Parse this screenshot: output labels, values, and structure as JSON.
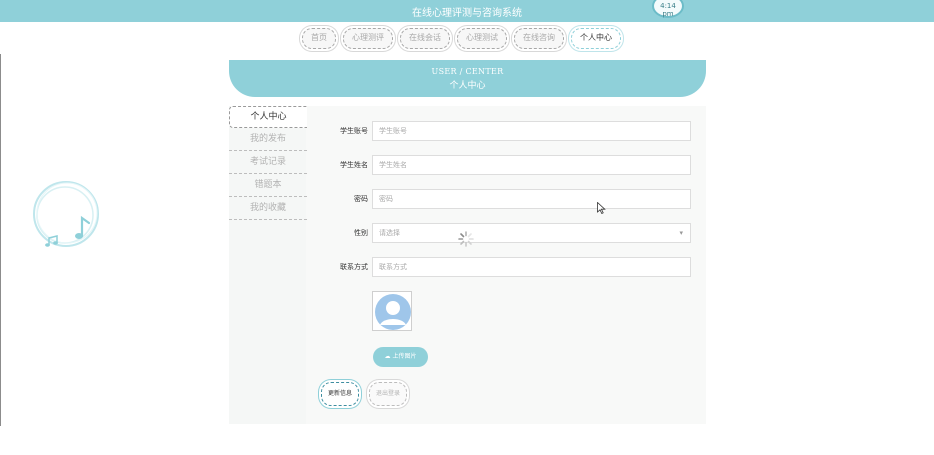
{
  "app": {
    "title": "在线心理评测与咨询系统",
    "time_badge": "4:14 pm"
  },
  "nav": {
    "items": [
      {
        "label": "首页"
      },
      {
        "label": "心理测评"
      },
      {
        "label": "在线会话"
      },
      {
        "label": "心理测试"
      },
      {
        "label": "在线咨询"
      },
      {
        "label": "个人中心"
      }
    ],
    "active_index": 5
  },
  "banner": {
    "en": "USER / CENTER",
    "zh": "个人中心"
  },
  "sidebar": {
    "items": [
      {
        "label": "个人中心"
      },
      {
        "label": "我的发布"
      },
      {
        "label": "考试记录"
      },
      {
        "label": "错题本"
      },
      {
        "label": "我的收藏"
      }
    ],
    "active_index": 0
  },
  "form": {
    "student_no": {
      "label": "学生账号",
      "placeholder": "学生账号"
    },
    "student_name": {
      "label": "学生姓名",
      "placeholder": "学生姓名"
    },
    "password": {
      "label": "密码",
      "placeholder": "密码"
    },
    "gender": {
      "label": "性别",
      "value": "请选择"
    },
    "contact": {
      "label": "联系方式",
      "placeholder": "联系方式"
    },
    "upload_label": "上传图片"
  },
  "actions": {
    "save_label": "更新信息",
    "logout_label": "退出登录"
  },
  "colors": {
    "accent": "#8fd0d9",
    "panel_bg": "#f5f7f6"
  }
}
